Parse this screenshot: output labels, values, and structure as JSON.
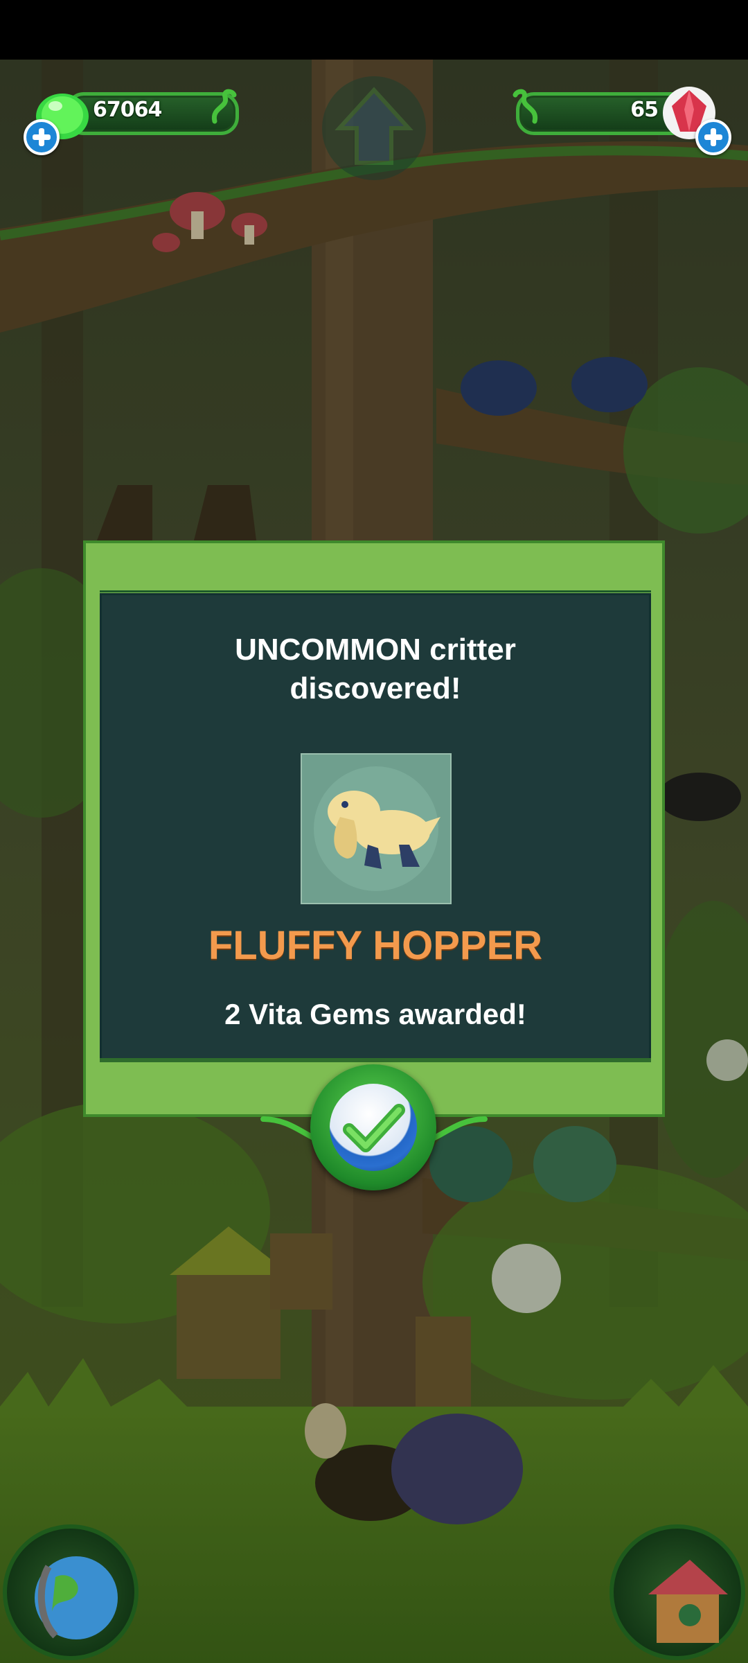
{
  "hud": {
    "slime_count": "67064",
    "gem_count": "65"
  },
  "dialog": {
    "heading_line1": "UNCOMMON critter",
    "heading_line2": "discovered!",
    "critter_name": "FLUFFY HOPPER",
    "reward": "2 Vita Gems awarded!"
  },
  "colors": {
    "frame_green": "#7ebd52",
    "panel_teal": "#1e3a3a",
    "name_orange": "#f39a4d",
    "confirm_blue": "#2a6fd0"
  },
  "icons": [
    "slime-icon",
    "gem-icon",
    "plus-icon",
    "home-arrow-icon",
    "check-icon",
    "globe-icon",
    "house-icon"
  ]
}
